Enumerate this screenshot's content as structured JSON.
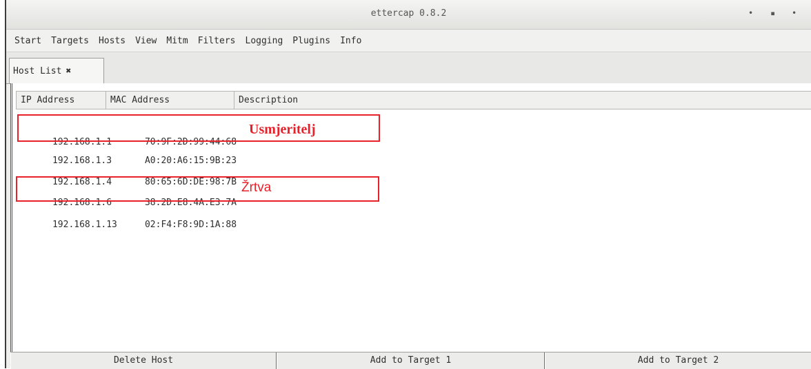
{
  "window": {
    "title": "ettercap 0.8.2"
  },
  "menu": [
    "Start",
    "Targets",
    "Hosts",
    "View",
    "Mitm",
    "Filters",
    "Logging",
    "Plugins",
    "Info"
  ],
  "tab": {
    "label": "Host List",
    "close": "✖"
  },
  "table": {
    "headers": [
      "IP Address",
      "MAC Address",
      "Description"
    ],
    "rows": [
      {
        "ip": "192.168.1.1",
        "mac": "70:9F:2D:99:44:68"
      },
      {
        "ip": "192.168.1.3",
        "mac": "A0:20:A6:15:9B:23"
      },
      {
        "ip": "192.168.1.4",
        "mac": "80:65:6D:DE:98:7B"
      },
      {
        "ip": "192.168.1.6",
        "mac": "38:2D:E8:4A:E3:7A"
      },
      {
        "ip": "192.168.1.13",
        "mac": "02:F4:F8:9D:1A:88"
      }
    ]
  },
  "annotations": {
    "router": "Usmjeritelj",
    "victim": "Žrtva",
    "color": "#e8202a"
  },
  "buttons": {
    "delete": "Delete Host",
    "target1": "Add to Target 1",
    "target2": "Add to Target 2"
  }
}
